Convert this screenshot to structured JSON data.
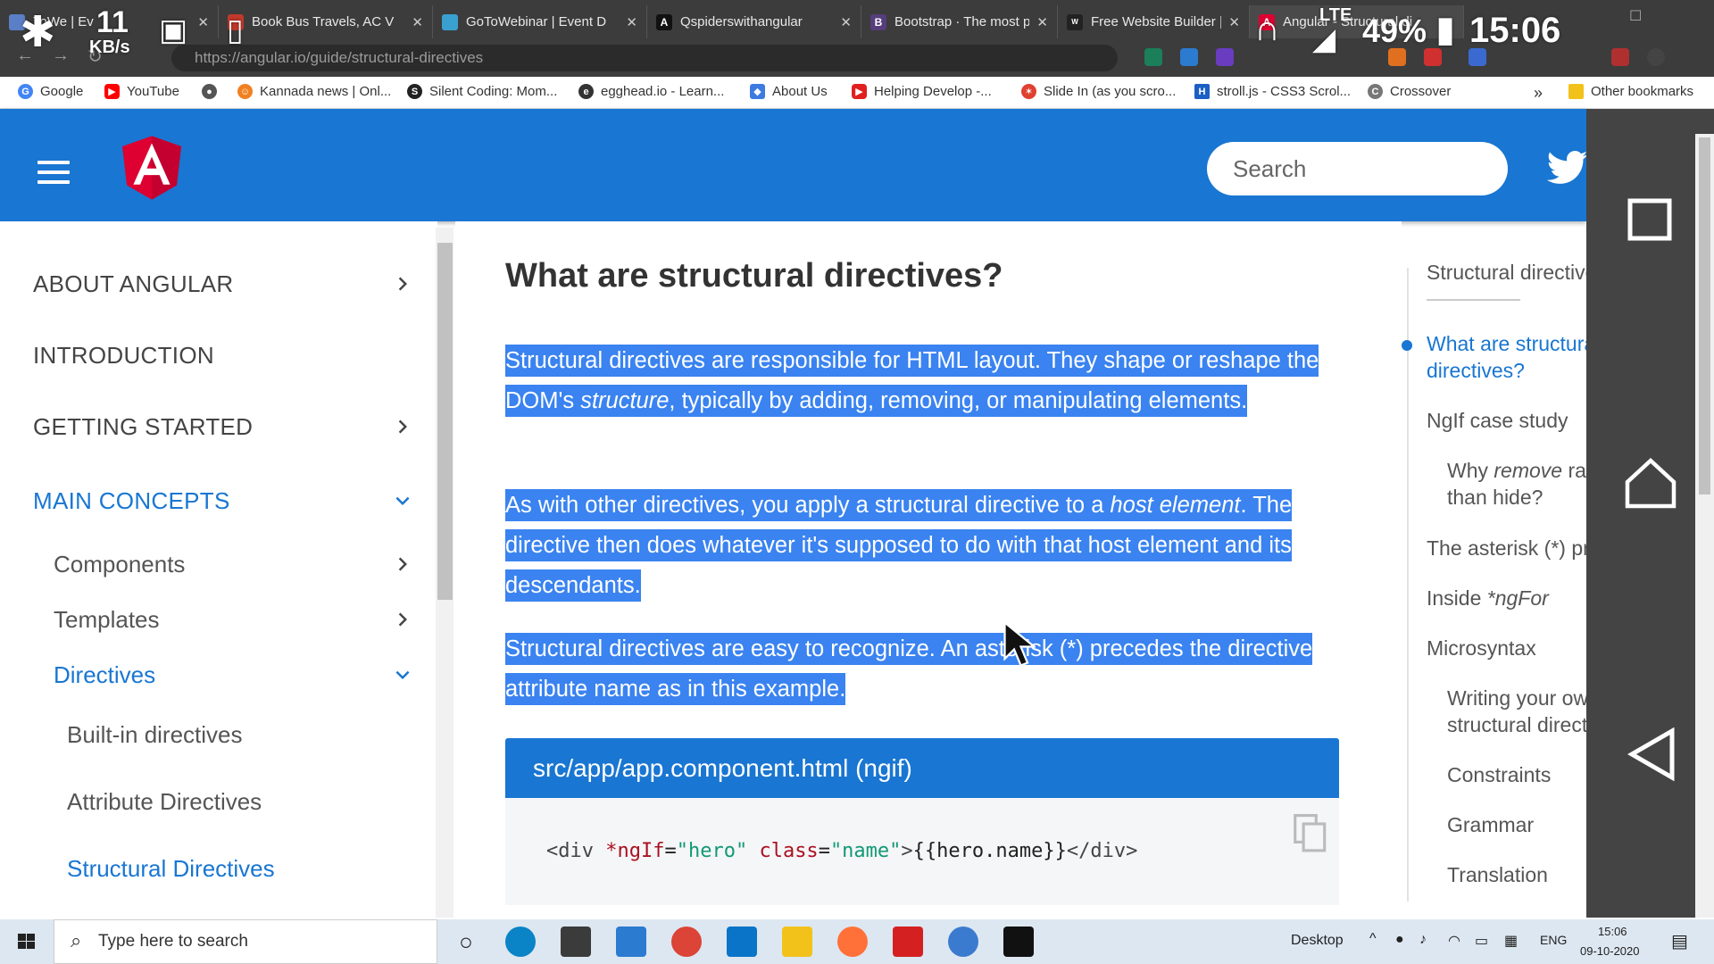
{
  "browser": {
    "tabs": [
      {
        "label": "ToWe | Ev",
        "fav_color": "#5b7fc7"
      },
      {
        "label": "Book Bus Travels, AC V",
        "fav_color": "#c0392b"
      },
      {
        "label": "GoToWebinar | Event D",
        "fav_color": "#3aa0d0"
      },
      {
        "label": "Qspiderswithangular",
        "fav_color": "#111111"
      },
      {
        "label": "Bootstrap · The most p",
        "fav_color": "#563d7c"
      },
      {
        "label": "Free Website Builder |",
        "fav_color": "#222222"
      },
      {
        "label": "Angular - Structural di",
        "fav_color": "#dd0031"
      }
    ],
    "url": "https://angular.io/guide/structural-directives",
    "bookmarks": [
      {
        "label": "Google",
        "color": "#4285f4",
        "glyph": "G"
      },
      {
        "label": "YouTube",
        "color": "#ff0000",
        "glyph": "▶"
      },
      {
        "label": "",
        "color": "#555555",
        "glyph": "●"
      },
      {
        "label": "Kannada news | Onl...",
        "color": "#f08020",
        "glyph": "☺"
      },
      {
        "label": "Silent Coding: Mom...",
        "color": "#222222",
        "glyph": "S"
      },
      {
        "label": "egghead.io - Learn...",
        "color": "#333333",
        "glyph": "e"
      },
      {
        "label": "About Us",
        "color": "#3d7be0",
        "glyph": "◆"
      },
      {
        "label": "Helping Develop -...",
        "color": "#e02020",
        "glyph": "▶"
      },
      {
        "label": "Slide In (as you scro...",
        "color": "#e04030",
        "glyph": "✶"
      },
      {
        "label": "stroll.js - CSS3 Scrol...",
        "color": "#1b5fc4",
        "glyph": "H"
      },
      {
        "label": "Crossover",
        "color": "#777777",
        "glyph": "C"
      }
    ],
    "bookmarks_overflow": "»",
    "other_bookmarks": "Other bookmarks"
  },
  "android_status": {
    "speed_value": "11",
    "speed_unit": "KB/s",
    "network": "LTE",
    "battery": "49%",
    "time": "15:06"
  },
  "header": {
    "search_placeholder": "Search"
  },
  "sidebar": {
    "items": [
      {
        "label": "ABOUT ANGULAR",
        "level": 1,
        "chevron": "right",
        "active": false
      },
      {
        "label": "INTRODUCTION",
        "level": 1,
        "chevron": "",
        "active": false
      },
      {
        "label": "GETTING STARTED",
        "level": 1,
        "chevron": "right",
        "active": false
      },
      {
        "label": "MAIN CONCEPTS",
        "level": 1,
        "chevron": "down",
        "active": true
      },
      {
        "label": "Components",
        "level": 2,
        "chevron": "right",
        "active": false
      },
      {
        "label": "Templates",
        "level": 2,
        "chevron": "right",
        "active": false
      },
      {
        "label": "Directives",
        "level": 2,
        "chevron": "down",
        "active": true
      },
      {
        "label": "Built-in directives",
        "level": 3,
        "chevron": "",
        "active": false
      },
      {
        "label": "Attribute Directives",
        "level": 3,
        "chevron": "",
        "active": false
      },
      {
        "label": "Structural Directives",
        "level": 3,
        "chevron": "",
        "active": true
      }
    ]
  },
  "main": {
    "title": "What are structural directives?",
    "p1_a": "Structural directives are responsible for HTML layout. They shape or reshape the DOM's ",
    "p1_em": "structure",
    "p1_b": ", typically by adding, removing, or manipulating elements.",
    "p2_a": "As with other directives, you apply a structural directive to a ",
    "p2_em": "host element",
    "p2_b": ". The directive then does whatever it's supposed to do with that host element and its descendants.",
    "p3": "Structural directives are easy to recognize. An asterisk (*) precedes the directive attribute name as in this example.",
    "code_title": "src/app/app.component.html (ngif)",
    "code": {
      "t1": "<div ",
      "a1": "*ngIf",
      "eq1": "=",
      "s1": "\"hero\"",
      "sp": " ",
      "a2": "class",
      "eq2": "=",
      "s2": "\"name\"",
      "t2": ">",
      "body": "{{hero.name}}",
      "t3": "</div>"
    }
  },
  "toc": {
    "title": "Structural directives",
    "items": [
      {
        "label": "What are structural",
        "label2": "directives?",
        "indent": false,
        "active": true
      },
      {
        "label": "NgIf case study",
        "indent": false,
        "active": false
      },
      {
        "label_a": "Why ",
        "label_em": "remove",
        "label_b": " rather",
        "label2": "than hide?",
        "indent": true,
        "active": false
      },
      {
        "label": "The asterisk (*) prefix",
        "indent": false,
        "active": false
      },
      {
        "label_a": "Inside ",
        "label_em": "*ngFor",
        "indent": false,
        "active": false
      },
      {
        "label": "Microsyntax",
        "indent": false,
        "active": false
      },
      {
        "label": "Writing your own",
        "label2": "structural directives",
        "indent": true,
        "active": false
      },
      {
        "label": "Constraints",
        "indent": true,
        "active": false
      },
      {
        "label": "Grammar",
        "indent": true,
        "active": false
      },
      {
        "label": "Translation",
        "indent": true,
        "active": false
      }
    ]
  },
  "taskbar": {
    "search_placeholder": "Type here to search",
    "desktop_label": "Desktop",
    "lang": "ENG",
    "time": "15:06",
    "date": "09-10-2020"
  },
  "colors": {
    "brand": "#1976d2",
    "selection": "#3a83f0"
  }
}
